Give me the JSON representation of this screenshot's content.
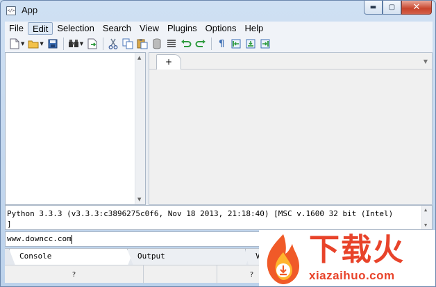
{
  "window": {
    "title": "App",
    "icon": "app-window-icon"
  },
  "menu": [
    "File",
    "Edit",
    "Selection",
    "Search",
    "View",
    "Plugins",
    "Options",
    "Help"
  ],
  "toolbar": {
    "icons": [
      "new-file-icon",
      "open-folder-icon",
      "save-icon",
      "binoculars-icon",
      "export-icon",
      "cut-icon",
      "copy-icon",
      "paste-icon",
      "delete-icon",
      "align-lines-icon",
      "undo-icon",
      "redo-icon",
      "pilcrow-icon",
      "indent-left-icon",
      "indent-center-icon",
      "indent-right-icon"
    ]
  },
  "editor": {
    "tab_label": "+"
  },
  "console": {
    "line1": "Python 3.3.3 (v3.3.3:c3896275c0f6, Nov 18 2013, 21:18:40) [MSC v.1600 32 bit (Intel)",
    "line2": "]"
  },
  "input": {
    "value": "www.downcc.com"
  },
  "bottom_tabs": [
    "Console",
    "Output",
    "V"
  ],
  "status": [
    "?",
    "?",
    "?",
    "?"
  ],
  "watermark": {
    "chinese": "下载火",
    "domain": "xiazaihuo.com",
    "color": "#e8432a"
  }
}
